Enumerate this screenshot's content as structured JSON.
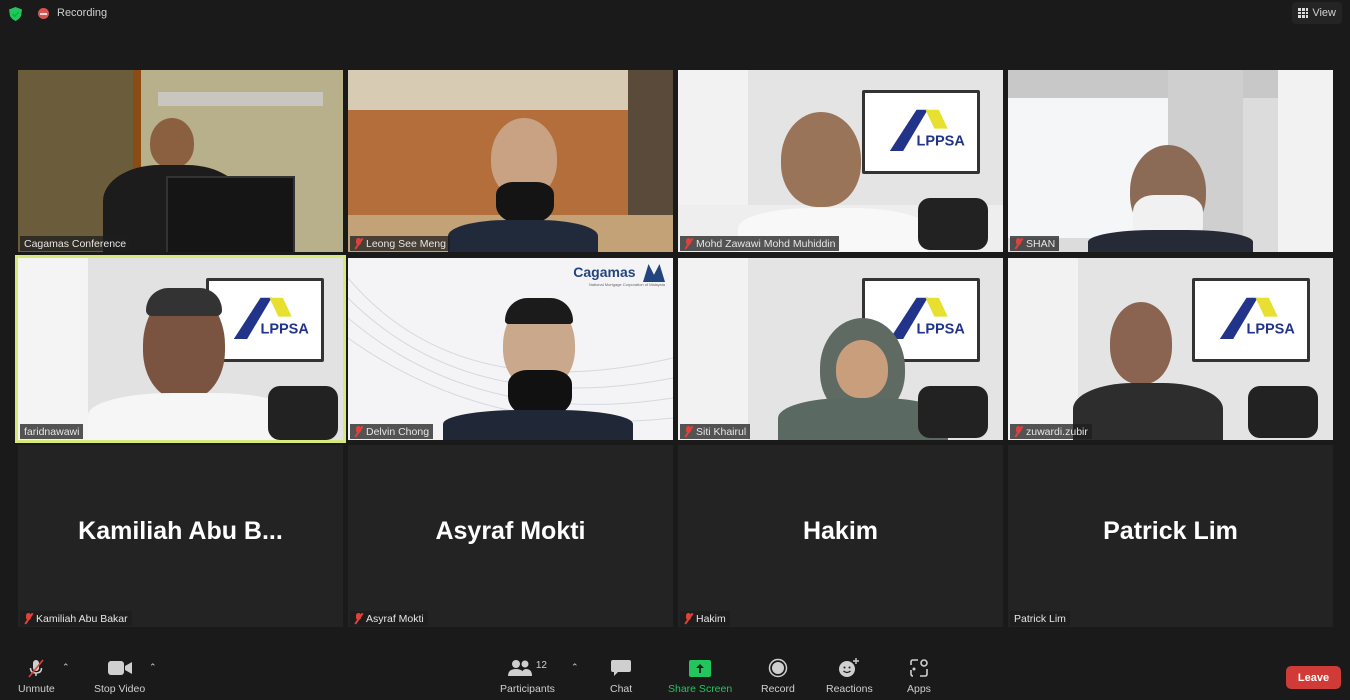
{
  "topbar": {
    "security_icon": "green-shield-icon",
    "recording_label": "Recording",
    "view_label": "View"
  },
  "tiles": [
    {
      "name": "Cagamas Conference",
      "muted": false,
      "video": true,
      "active": false
    },
    {
      "name": "Leong See Meng",
      "muted": true,
      "video": true,
      "active": false
    },
    {
      "name": "Mohd Zawawi Mohd Muhiddin",
      "muted": true,
      "video": true,
      "active": false
    },
    {
      "name": "SHAN",
      "muted": true,
      "video": true,
      "active": false
    },
    {
      "name": "faridnawawi",
      "muted": false,
      "video": true,
      "active": true
    },
    {
      "name": "Delvin Chong",
      "muted": true,
      "video": true,
      "active": false
    },
    {
      "name": "Siti Khairul",
      "muted": true,
      "video": true,
      "active": false
    },
    {
      "name": "zuwardi.zubir",
      "muted": true,
      "video": true,
      "active": false
    },
    {
      "name": "Kamiliah Abu Bakar",
      "display_name": "Kamiliah  Abu  B...",
      "muted": true,
      "video": false,
      "active": false
    },
    {
      "name": "Asyraf Mokti",
      "display_name": "Asyraf Mokti",
      "muted": true,
      "video": false,
      "active": false
    },
    {
      "name": "Hakim",
      "display_name": "Hakim",
      "muted": true,
      "video": false,
      "active": false
    },
    {
      "name": "Patrick Lim",
      "display_name": "Patrick Lim",
      "muted": false,
      "video": false,
      "active": false
    }
  ],
  "backgrounds": {
    "lpppsa_logo_text": "LPPSA",
    "cagamas_logo_text": "Cagamas",
    "cagamas_tagline": "National Mortgage Corporation of Malaysia"
  },
  "toolbar": {
    "unmute": "Unmute",
    "stop_video": "Stop Video",
    "participants": "Participants",
    "participants_count": "12",
    "chat": "Chat",
    "share_screen": "Share Screen",
    "record": "Record",
    "reactions": "Reactions",
    "apps": "Apps",
    "leave": "Leave",
    "share_color": "#22c55e",
    "leave_color": "#d03a37"
  }
}
